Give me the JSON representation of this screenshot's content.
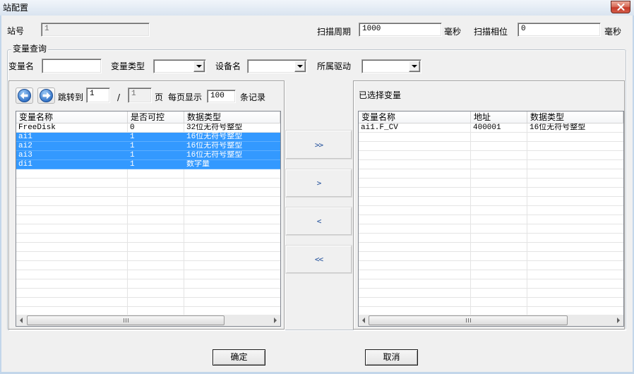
{
  "window": {
    "title": "站配置"
  },
  "station": {
    "station_no": {
      "label": "站号",
      "value": "1"
    },
    "scan_period": {
      "label": "扫描周期",
      "value": "1000",
      "unit": "毫秒"
    },
    "scan_phase": {
      "label": "扫描相位",
      "value": "0",
      "unit": "毫秒"
    }
  },
  "query": {
    "group_label": "变量查询",
    "var_name_label": "变量名",
    "var_type_label": "变量类型",
    "device_label": "设备名",
    "driver_label": "所属驱动"
  },
  "pager": {
    "jump_label": "跳转到",
    "current_page": "1",
    "separator": "/",
    "total_pages": "1",
    "page_unit": "页",
    "per_page_label": "每页显示",
    "per_page": "100",
    "records_unit": "条记录"
  },
  "available": {
    "columns": [
      "变量名称",
      "是否可控",
      "数据类型"
    ],
    "rows": [
      {
        "name": "FreeDisk",
        "controllable": "0",
        "type": "32位无符号整型",
        "selected": false
      },
      {
        "name": "ai1",
        "controllable": "1",
        "type": "16位无符号整型",
        "selected": true
      },
      {
        "name": "ai2",
        "controllable": "1",
        "type": "16位无符号整型",
        "selected": true
      },
      {
        "name": "ai3",
        "controllable": "1",
        "type": "16位无符号整型",
        "selected": true
      },
      {
        "name": "di1",
        "controllable": "1",
        "type": "数字量",
        "selected": true
      }
    ]
  },
  "transfer": {
    "add_all": ">>",
    "add": ">",
    "remove": "<",
    "remove_all": "<<"
  },
  "selected_vars": {
    "title": "已选择变量",
    "columns": [
      "变量名称",
      "地址",
      "数据类型"
    ],
    "rows": [
      {
        "name": "ai1.F_CV",
        "address": "400001",
        "type": "16位无符号整型"
      }
    ]
  },
  "footer": {
    "ok": "确定",
    "cancel": "取消"
  },
  "colors": {
    "selection": "#3399ff",
    "selection_text": "#ffffff",
    "transfer_text": "#1f4e9a",
    "window_bg": "#f0f0f0"
  },
  "icons": {
    "close": "close-icon",
    "prev_page": "arrow-left-circle-icon",
    "next_page": "arrow-right-circle-icon",
    "dropdown": "chevron-down-icon",
    "scroll_left": "scroll-left-arrow-icon",
    "scroll_right": "scroll-right-arrow-icon",
    "scroll_grip": "grip-icon"
  }
}
